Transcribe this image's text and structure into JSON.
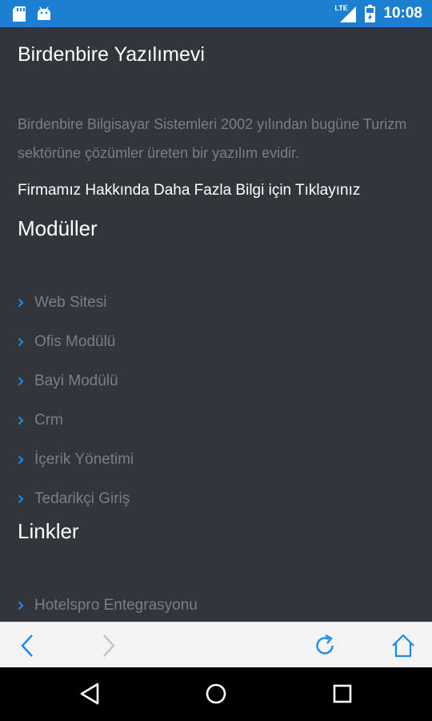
{
  "status_bar": {
    "time": "10:08",
    "network": "LTE",
    "icons": [
      "sd-card-icon",
      "android-icon",
      "lte-signal-icon",
      "battery-icon"
    ]
  },
  "page": {
    "title": "Birdenbire Yazılımevi",
    "about_text": "Birdenbire Bilgisayar Sistemleri 2002 yılından bugüne Turizm sektörüne çözümler üreten bir yazılım evidir.",
    "more_link": "Firmamız Hakkında Daha Fazla Bilgi için Tıklayınız",
    "modules": {
      "heading": "Modüller",
      "items": [
        "Web Sitesi",
        "Ofis Modülü",
        "Bayi Modülü",
        "Crm",
        "İçerik Yönetimi",
        "Tedarikçi Giriş"
      ]
    },
    "links": {
      "heading": "Linkler",
      "items": [
        "Hotelspro Entegrasyonu"
      ]
    }
  },
  "browser_toolbar": {
    "buttons": [
      "back-icon",
      "forward-icon",
      "refresh-icon",
      "home-icon"
    ]
  },
  "system_nav": {
    "buttons": [
      "nav-back-icon",
      "nav-home-icon",
      "nav-recents-icon"
    ]
  },
  "colors": {
    "status_bar": "#1b7fd3",
    "background": "#32353a",
    "accent": "#1e88e5",
    "muted_text": "#7b7f85",
    "heading_text": "#ffffff",
    "toolbar_bg": "#f3f3f3"
  }
}
